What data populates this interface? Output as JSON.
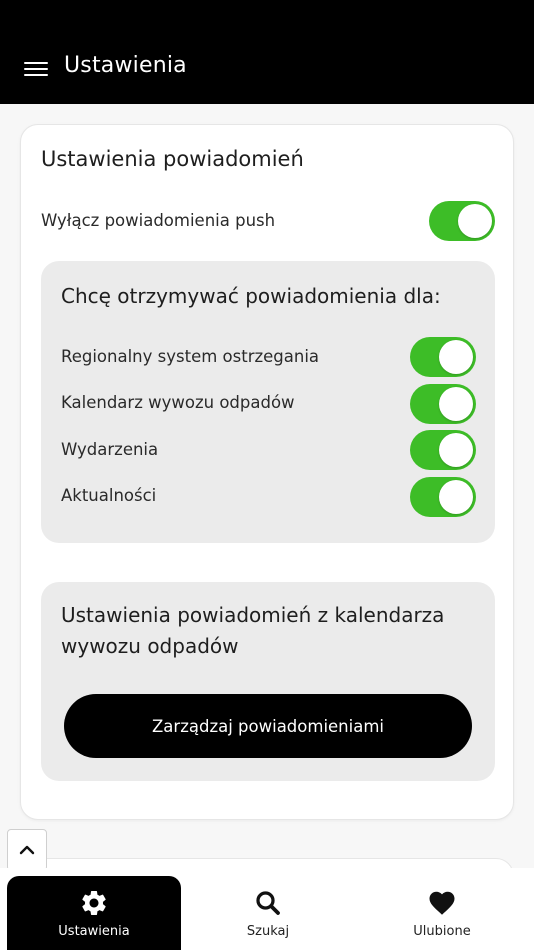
{
  "appbar": {
    "title": "Ustawienia",
    "menu_icon": "hamburger-menu-icon"
  },
  "notifications": {
    "title": "Ustawienia powiadomień",
    "push_label": "Wyłącz powiadomienia push",
    "push_on": true,
    "panel_title": "Chcę otrzymywać powiadomienia dla:",
    "items": [
      {
        "label": "Regionalny system ostrzegania",
        "on": true
      },
      {
        "label": "Kalendarz wywozu odpadów",
        "on": true
      },
      {
        "label": "Wydarzenia",
        "on": true
      },
      {
        "label": "Aktualności",
        "on": true
      }
    ],
    "waste_panel_title_line1": "Ustawienia powiadomień z kalendarza",
    "waste_panel_title_line2": "wywozu odpadów",
    "manage_button": "Zarządzaj powiadomieniami"
  },
  "nav": {
    "items": [
      {
        "label": "Ustawienia",
        "icon": "gear-icon",
        "active": true
      },
      {
        "label": "Szukaj",
        "icon": "search-icon",
        "active": false
      },
      {
        "label": "Ulubione",
        "icon": "heart-icon",
        "active": false
      }
    ]
  },
  "colors": {
    "accent_green": "#3dbd27",
    "appbar_bg": "#000000",
    "panel_bg": "#ebebeb"
  }
}
